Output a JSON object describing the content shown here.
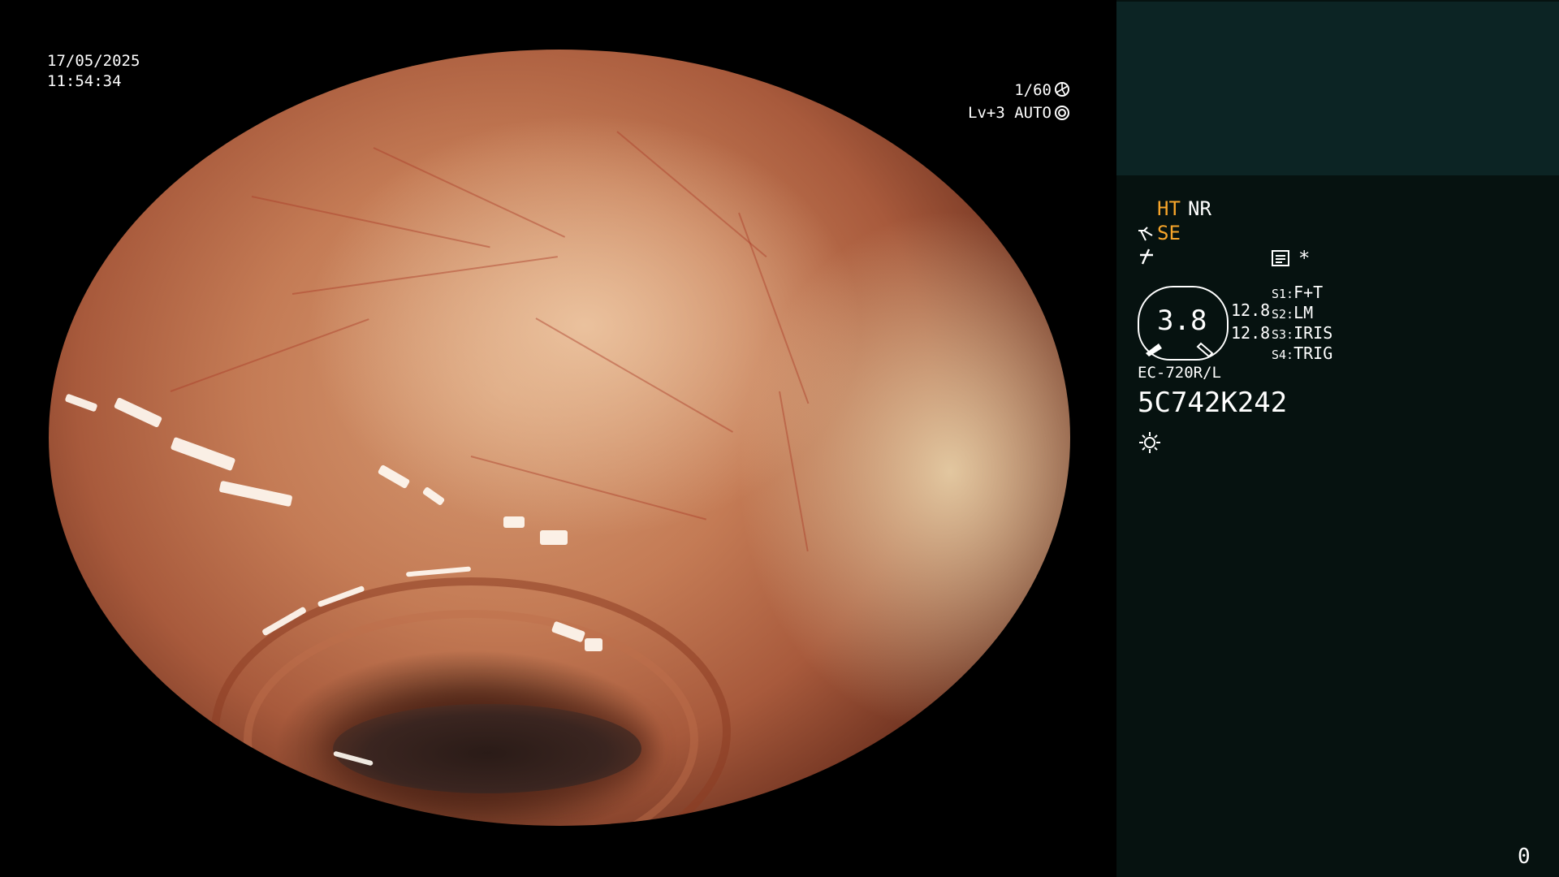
{
  "overlay": {
    "date": "17/05/2025",
    "time": "11:54:34",
    "shutter": "1/60",
    "level": "Lv+3 AUTO"
  },
  "panel": {
    "mode_ht": "HT",
    "mode_nr": "NR",
    "mode_se": "SE",
    "asterisk": "*",
    "gauge_value": "3.8",
    "value_1": "12.8",
    "value_2": "12.8",
    "switches": [
      {
        "key": "S1:",
        "value": "F+T"
      },
      {
        "key": "S2:",
        "value": "LM"
      },
      {
        "key": "S3:",
        "value": "IRIS"
      },
      {
        "key": "S4:",
        "value": "TRIG"
      }
    ],
    "scope_model": "EC-720R/L",
    "serial": "5C742K242",
    "counter": "0"
  },
  "colors": {
    "panel_bg": "#061210",
    "panel_top_bg": "#0c2424",
    "accent_orange": "#f7a52a"
  },
  "icons": [
    "shutter-icon",
    "iris-icon",
    "scope-icon",
    "lightning-icon",
    "memory-icon",
    "light-icon"
  ]
}
